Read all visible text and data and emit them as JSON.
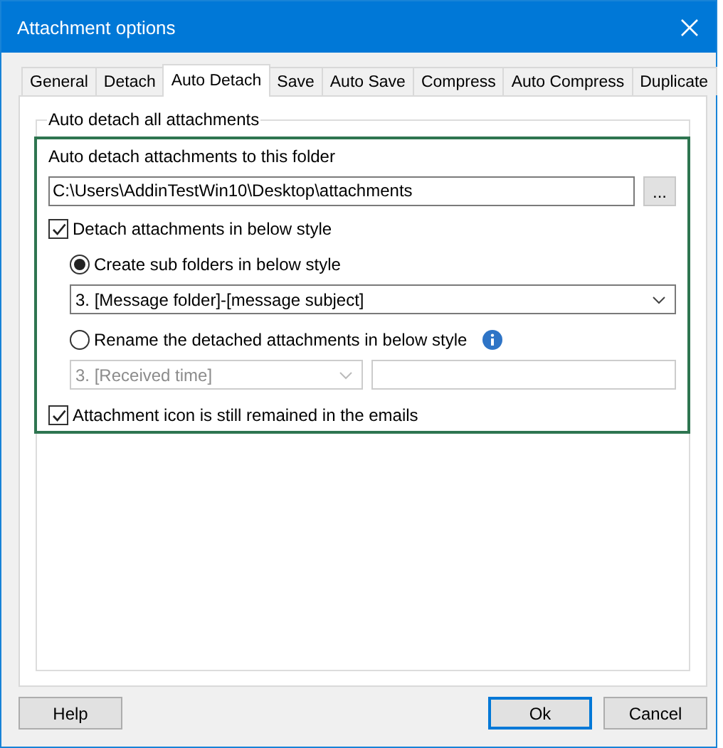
{
  "window": {
    "title": "Attachment options"
  },
  "tabs": [
    {
      "label": "General",
      "selected": false
    },
    {
      "label": "Detach",
      "selected": false
    },
    {
      "label": "Auto Detach",
      "selected": true
    },
    {
      "label": "Save",
      "selected": false
    },
    {
      "label": "Auto Save",
      "selected": false
    },
    {
      "label": "Compress",
      "selected": false
    },
    {
      "label": "Auto Compress",
      "selected": false
    },
    {
      "label": "Duplicate",
      "selected": false
    }
  ],
  "group": {
    "title": "Auto detach all attachments"
  },
  "folder": {
    "label": "Auto detach attachments to this folder",
    "value": "C:\\Users\\AddinTestWin10\\Desktop\\attachments",
    "browse": "..."
  },
  "detach_style": {
    "label": "Detach attachments in below style",
    "checked": true
  },
  "options": [
    {
      "kind": "folders",
      "label": "Create sub folders in below style",
      "selected": true,
      "dropdown": {
        "value": "3. [Message folder]-[message subject]",
        "disabled": false
      }
    },
    {
      "kind": "rename",
      "label": "Rename the detached attachments in below style",
      "selected": false,
      "dropdown": {
        "value": "3. [Received time]",
        "disabled": true
      }
    }
  ],
  "keep_icon": {
    "label": "Attachment icon is still remained in the emails",
    "checked": true
  },
  "buttons": [
    {
      "label": "Help",
      "default": false
    },
    {
      "label": "Ok",
      "default": true
    },
    {
      "label": "Cancel",
      "default": false
    }
  ]
}
